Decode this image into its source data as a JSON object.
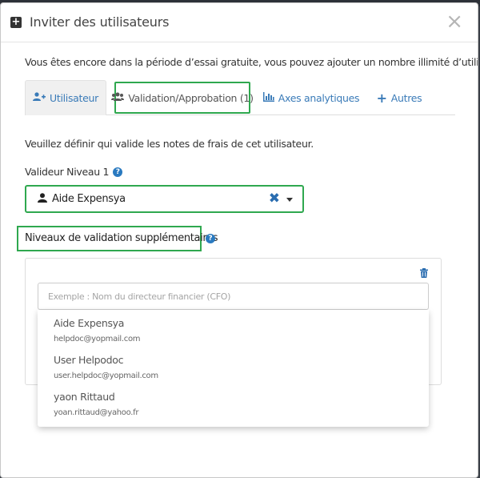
{
  "modal": {
    "title": "Inviter des utilisateurs",
    "close": "×",
    "trial_notice": "Vous êtes encore dans la période d’essai gratuite, vous pouvez ajouter un nombre illimité d’utilisateurs."
  },
  "tabs": [
    {
      "label": "Utilisateur",
      "icon": "user-plus-icon"
    },
    {
      "label": "Validation/Approbation (1)",
      "icon": "users-icon"
    },
    {
      "label": "Axes analytiques",
      "icon": "bar-chart-icon"
    },
    {
      "label": "Autres",
      "icon": "plus-icon"
    }
  ],
  "form": {
    "description": "Veuillez définir qui valide les notes de frais de cet utilisateur.",
    "level1_label": "Valideur Niveau 1",
    "level1_value": "Aide Expensya",
    "additional_label": "Niveaux de validation supplémentaires",
    "search_placeholder": "Exemple : Nom du directeur financier (CFO)"
  },
  "dropdown": [
    {
      "name": "Aide Expensya",
      "email": "helpdoc@yopmail.com"
    },
    {
      "name": "User Helpodoc",
      "email": "user.helpdoc@yopmail.com"
    },
    {
      "name": "yaon Rittaud",
      "email": "yoan.rittaud@yahoo.fr"
    }
  ],
  "colors": {
    "accent": "#2a7ac0",
    "highlight": "#2fa84f"
  }
}
